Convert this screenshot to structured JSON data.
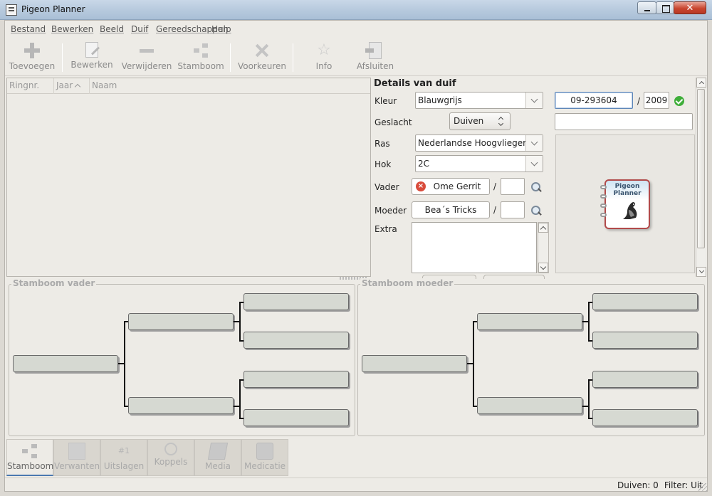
{
  "window": {
    "title": "Pigeon Planner",
    "close_glyph": "✕"
  },
  "menu": [
    "Bestand",
    "Bewerken",
    "Beeld",
    "Duif",
    "Gereedschappen",
    "Hulp"
  ],
  "toolbar": {
    "add": "Toevoegen",
    "edit": "Bewerken",
    "remove": "Verwijderen",
    "pedigree": "Stamboom",
    "prefs": "Voorkeuren",
    "info": "Info",
    "quit": "Afsluiten"
  },
  "list": {
    "columns": [
      "Ringnr.",
      "Jaar",
      "Naam"
    ]
  },
  "details": {
    "title": "Details van duif",
    "labels": {
      "color": "Kleur",
      "sex": "Geslacht",
      "strain": "Ras",
      "loft": "Hok",
      "sire": "Vader",
      "dam": "Moeder",
      "extra": "Extra"
    },
    "color": "Blauwgrijs",
    "sex": "Duiven",
    "strain": "Nederlandse Hoogvlieger",
    "loft": "2C",
    "sire_name": "Ome Gerrit",
    "dam_name": "Bea´s Tricks",
    "ring": "09-293604",
    "year": "2009",
    "name": "",
    "extra": "",
    "logo_text": "Pigeon\nPlanner"
  },
  "pedigree": {
    "sire_title": "Stamboom vader",
    "dam_title": "Stamboom moeder"
  },
  "tabs": [
    "Stamboom",
    "Verwanten",
    "Uitslagen",
    "Koppels",
    "Media",
    "Medicatie"
  ],
  "tab_num_glyph": "#1",
  "status": {
    "pigeons": "Duiven: 0",
    "filter": "Filter: Uit"
  }
}
